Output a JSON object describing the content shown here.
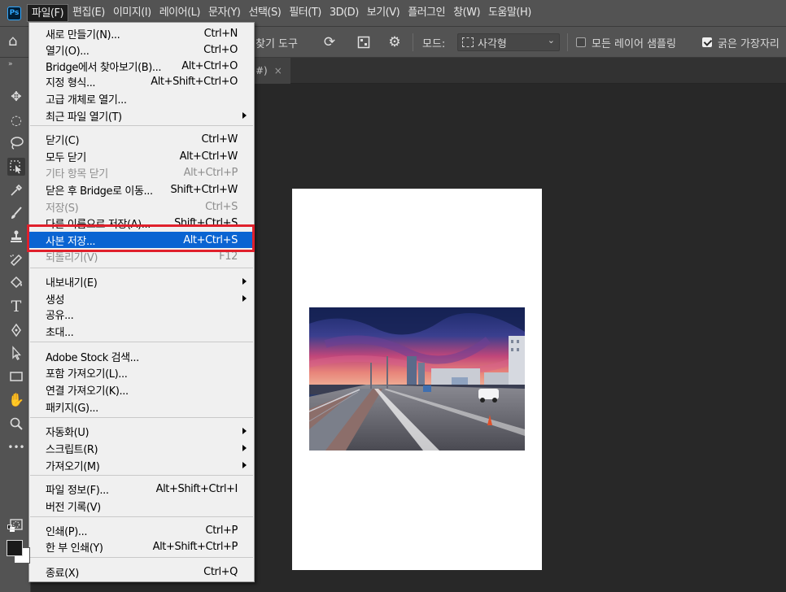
{
  "app_logo": "Ps",
  "menubar": {
    "items": [
      "파일(F)",
      "편집(E)",
      "이미지(I)",
      "레이어(L)",
      "문자(Y)",
      "선택(S)",
      "필터(T)",
      "3D(D)",
      "보기(V)",
      "플러그인",
      "창(W)",
      "도움말(H)"
    ],
    "active_index": 0
  },
  "options_bar": {
    "partial_label": "찾기 도구",
    "mode_label": "모드:",
    "mode_value": "사각형",
    "sample_all_layers": {
      "label": "모든 레이어 샘플링",
      "checked": false
    },
    "hard_edge": {
      "label": "굵은 가장자리",
      "checked": true
    }
  },
  "document_tab": {
    "partial_title": "#)",
    "close_glyph": "×"
  },
  "file_menu": {
    "items": [
      {
        "label": "새로 만들기(N)...",
        "shortcut": "Ctrl+N"
      },
      {
        "label": "열기(O)...",
        "shortcut": "Ctrl+O"
      },
      {
        "label": "Bridge에서 찾아보기(B)...",
        "shortcut": "Alt+Ctrl+O"
      },
      {
        "label": "지정 형식...",
        "shortcut": "Alt+Shift+Ctrl+O"
      },
      {
        "label": "고급 개체로 열기...",
        "shortcut": ""
      },
      {
        "label": "최근 파일 열기(T)",
        "shortcut": "",
        "submenu": true
      },
      {
        "separator": true
      },
      {
        "label": "닫기(C)",
        "shortcut": "Ctrl+W"
      },
      {
        "label": "모두 닫기",
        "shortcut": "Alt+Ctrl+W"
      },
      {
        "label": "기타 항목 닫기",
        "shortcut": "Alt+Ctrl+P",
        "disabled": true
      },
      {
        "label": "닫은 후 Bridge로 이동...",
        "shortcut": "Shift+Ctrl+W"
      },
      {
        "label": "저장(S)",
        "shortcut": "Ctrl+S",
        "disabled": true
      },
      {
        "label": "다른 이름으로 저장(A)...",
        "shortcut": "Shift+Ctrl+S"
      },
      {
        "label": "사본 저장...",
        "shortcut": "Alt+Ctrl+S",
        "highlighted": true
      },
      {
        "label": "되돌리기(V)",
        "shortcut": "F12",
        "disabled": true
      },
      {
        "separator": true
      },
      {
        "label": "내보내기(E)",
        "shortcut": "",
        "submenu": true
      },
      {
        "label": "생성",
        "shortcut": "",
        "submenu": true
      },
      {
        "label": "공유...",
        "shortcut": ""
      },
      {
        "label": "초대...",
        "shortcut": ""
      },
      {
        "separator": true
      },
      {
        "label": "Adobe Stock 검색...",
        "shortcut": ""
      },
      {
        "label": "포함 가져오기(L)...",
        "shortcut": ""
      },
      {
        "label": "연결 가져오기(K)...",
        "shortcut": ""
      },
      {
        "label": "패키지(G)...",
        "shortcut": ""
      },
      {
        "separator": true
      },
      {
        "label": "자동화(U)",
        "shortcut": "",
        "submenu": true
      },
      {
        "label": "스크립트(R)",
        "shortcut": "",
        "submenu": true
      },
      {
        "label": "가져오기(M)",
        "shortcut": "",
        "submenu": true
      },
      {
        "separator": true
      },
      {
        "label": "파일 정보(F)...",
        "shortcut": "Alt+Shift+Ctrl+I"
      },
      {
        "label": "버전 기록(V)",
        "shortcut": ""
      },
      {
        "separator": true
      },
      {
        "label": "인쇄(P)...",
        "shortcut": "Ctrl+P"
      },
      {
        "label": "한 부 인쇄(Y)",
        "shortcut": "Alt+Shift+Ctrl+P"
      },
      {
        "separator": true
      },
      {
        "label": "종료(X)",
        "shortcut": "Ctrl+Q"
      }
    ]
  },
  "toolbar_tools": [
    "move-tool-icon",
    "elliptical-marquee-icon",
    "lasso-icon",
    "object-selection-icon",
    "eyedropper-icon",
    "brush-icon",
    "clone-stamp-icon",
    "magic-eraser-icon",
    "paint-bucket-icon",
    "type-tool-icon",
    "pen-tool-icon",
    "path-selection-icon",
    "rectangle-tool-icon",
    "hand-tool-icon",
    "zoom-tool-icon",
    "more-tools-icon"
  ],
  "colors": {
    "menu_highlight": "#0a64d2",
    "callout_border": "#e0202c",
    "ui_panel": "#535353",
    "workspace": "#282828"
  }
}
